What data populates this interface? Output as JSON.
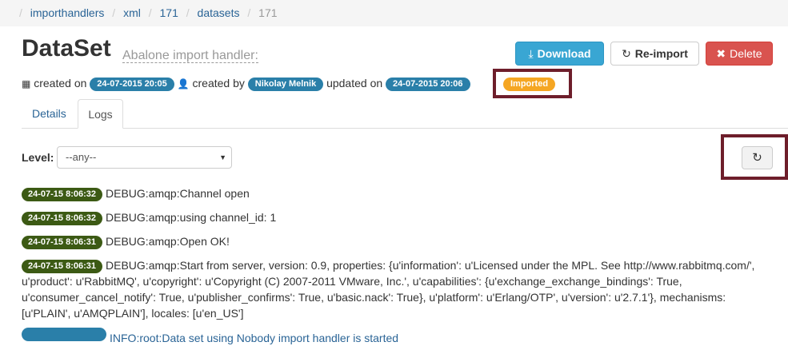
{
  "breadcrumb": {
    "items": [
      "importhandlers",
      "xml",
      "171",
      "datasets"
    ],
    "current": "171"
  },
  "header": {
    "title": "DataSet",
    "subtitle": "Abalone import handler:"
  },
  "actions": {
    "download": "Download",
    "reimport": "Re-import",
    "delete": "Delete"
  },
  "meta": {
    "created_on_label": "created on",
    "created_on": "24-07-2015 20:05",
    "created_by_label": "created by",
    "created_by": "Nikolay Melnik",
    "updated_on_label": "updated on",
    "updated_on": "24-07-2015 20:06",
    "status": "Imported"
  },
  "tabs": {
    "details": "Details",
    "logs": "Logs"
  },
  "filter": {
    "level_label": "Level:",
    "level_value": "--any--"
  },
  "logs": [
    {
      "ts": "24-07-15 8:06:32",
      "msg": "DEBUG:amqp:Channel open"
    },
    {
      "ts": "24-07-15 8:06:32",
      "msg": "DEBUG:amqp:using channel_id: 1"
    },
    {
      "ts": "24-07-15 8:06:31",
      "msg": "DEBUG:amqp:Open OK!"
    },
    {
      "ts": "24-07-15 8:06:31",
      "msg": "DEBUG:amqp:Start from server, version: 0.9, properties: {u'information': u'Licensed under the MPL. See http://www.rabbitmq.com/', u'product': u'RabbitMQ', u'copyright': u'Copyright (C) 2007-2011 VMware, Inc.', u'capabilities': {u'exchange_exchange_bindings': True, u'consumer_cancel_notify': True, u'publisher_confirms': True, u'basic.nack': True}, u'platform': u'Erlang/OTP', u'version': u'2.7.1'}, mechanisms: [u'PLAIN', u'AMQPLAIN'], locales: [u'en_US']"
    },
    {
      "ts": "",
      "msg": "INFO:root:Data set using Nobody import handler is started"
    }
  ],
  "colors": {
    "highlight": "#6e1e2b",
    "debug_badge": "#3c5a14",
    "info_badge": "#2a7fa9",
    "status_badge": "#f5a623"
  }
}
